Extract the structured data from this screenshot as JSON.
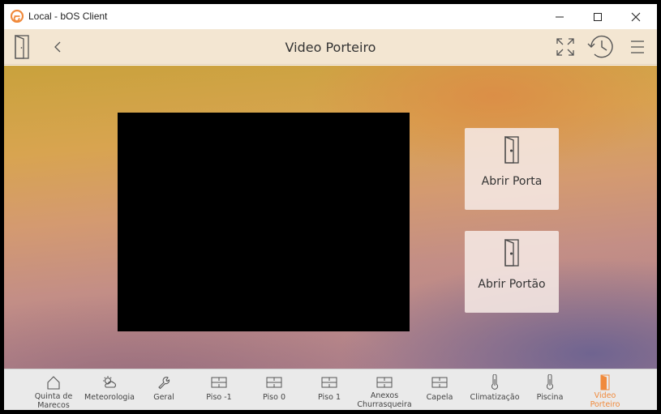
{
  "window": {
    "title": "Local - bOS Client",
    "accent": "#f08a3c"
  },
  "header": {
    "title": "Video Porteiro",
    "icons": [
      "door-icon",
      "back-chevron-icon",
      "fullscreen-icon",
      "history-clock-icon",
      "menu-icon"
    ]
  },
  "main": {
    "actions": [
      {
        "label": "Abrir Porta",
        "icon": "door-open-icon"
      },
      {
        "label": "Abrir Portão",
        "icon": "door-open-icon"
      }
    ]
  },
  "nav": {
    "items": [
      {
        "label": "Quinta de\nMarecos",
        "icon": "house-icon"
      },
      {
        "label": "Meteorologia",
        "icon": "weather-icon"
      },
      {
        "label": "Geral",
        "icon": "wrench-icon"
      },
      {
        "label": "Piso -1",
        "icon": "floorplan-icon"
      },
      {
        "label": "Piso 0",
        "icon": "floorplan-icon"
      },
      {
        "label": "Piso 1",
        "icon": "floorplan-icon"
      },
      {
        "label": "Anexos\nChurrasqueira",
        "icon": "floorplan-icon"
      },
      {
        "label": "Capela",
        "icon": "floorplan-icon"
      },
      {
        "label": "Climatização",
        "icon": "thermometer-icon"
      },
      {
        "label": "Piscina",
        "icon": "thermometer-icon"
      },
      {
        "label": "Video\nPorteiro",
        "icon": "door-icon",
        "active": true
      }
    ]
  }
}
